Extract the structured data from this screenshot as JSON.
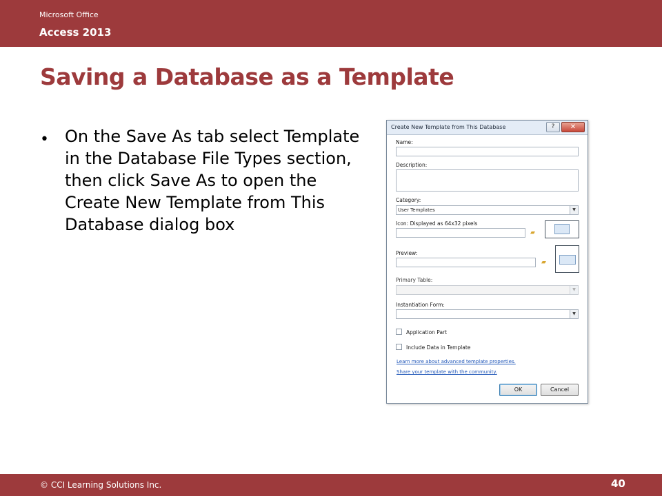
{
  "header": {
    "brand_line1": "Microsoft Office",
    "brand_line2": "Access 2013"
  },
  "slide": {
    "title": "Saving a Database as a Template",
    "bullet": "On the Save As tab select Template in the Database File Types section, then click Save As to open the Create New Template from This Database dialog box"
  },
  "footer": {
    "copyright": "© CCI Learning Solutions Inc.",
    "page_number": "40"
  },
  "dialog": {
    "title": "Create New Template from This Database",
    "help_label": "?",
    "close_label": "✕",
    "name_label": "Name:",
    "name_value": "",
    "description_label": "Description:",
    "description_value": "",
    "category_label": "Category:",
    "category_value": "User Templates",
    "icon_label": "Icon: Displayed as 64x32 pixels",
    "icon_value": "",
    "preview_label": "Preview:",
    "preview_value": "",
    "primary_table_label": "Primary Table:",
    "primary_table_value": "",
    "instantiation_form_label": "Instantiation Form:",
    "instantiation_form_value": "",
    "application_part_label": "Application Part",
    "application_part_checked": false,
    "include_data_label": "Include Data in Template",
    "include_data_checked": false,
    "link_advanced": "Learn more about advanced template properties.",
    "link_share": "Share your template with the community.",
    "ok_label": "OK",
    "cancel_label": "Cancel"
  },
  "icons": {
    "dropdown": "chevron-down-icon",
    "folder": "folder-icon",
    "close": "close-icon",
    "help": "help-icon"
  },
  "colors": {
    "brand": "#9d3a3c",
    "link": "#1f56b8"
  }
}
